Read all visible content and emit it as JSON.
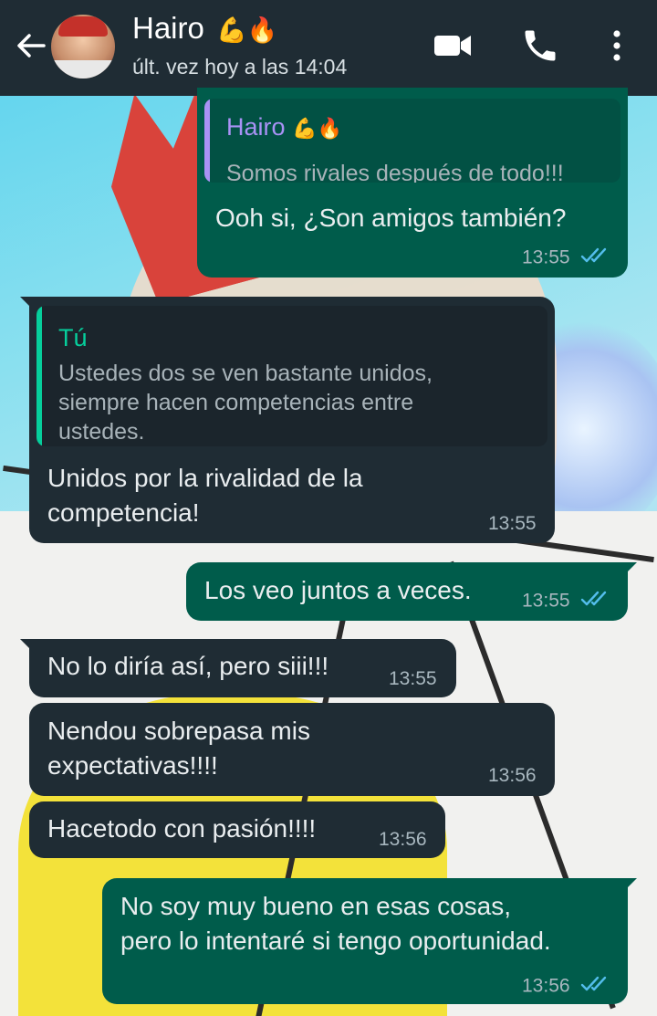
{
  "header": {
    "name": "Hairo",
    "name_emojis": "💪🔥",
    "status": "últ. vez hoy a las 14:04",
    "icons": [
      "back-arrow-icon",
      "video-call-icon",
      "phone-icon",
      "more-vert-icon"
    ]
  },
  "messages": [
    {
      "direction": "out",
      "quote": {
        "author": "Hairo",
        "author_emojis": "💪🔥",
        "text": "Somos rivales después de todo!!!"
      },
      "text": "Ooh si, ¿Son amigos también?",
      "time": "13:55",
      "read": true
    },
    {
      "direction": "in",
      "quote": {
        "author": "Tú",
        "text": "Ustedes dos se ven bastante unidos, siempre hacen competencias entre ustedes."
      },
      "text": "Unidos por la rivalidad de la competencia!",
      "time": "13:55"
    },
    {
      "direction": "out",
      "text": "Los veo juntos a veces.",
      "time": "13:55",
      "read": true
    },
    {
      "direction": "in",
      "text": "No lo diría así, pero siii!!!",
      "time": "13:55"
    },
    {
      "direction": "in",
      "text": "Nendou sobrepasa mis expectativas!!!!",
      "time": "13:56"
    },
    {
      "direction": "in",
      "text": "Hacetodo con pasión!!!!",
      "time": "13:56"
    },
    {
      "direction": "out",
      "text": "No soy muy bueno en esas cosas, pero lo intentaré si tengo oportunidad.",
      "time": "13:56",
      "read": true
    }
  ],
  "colors": {
    "header_bg": "#1f2c34",
    "outgoing_bubble": "#005c4b",
    "incoming_bubble": "#1f2c34",
    "read_ticks": "#53bdeb",
    "quote_author_hairo": "#a992f5",
    "quote_author_you": "#06cf9c"
  }
}
